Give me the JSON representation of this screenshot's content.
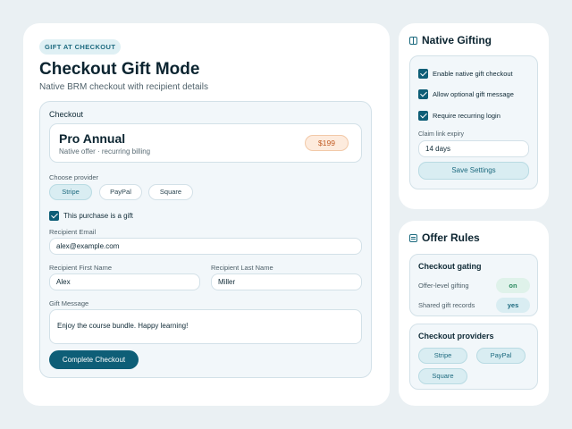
{
  "main": {
    "badge": "GIFT AT CHECKOUT",
    "title": "Checkout Gift Mode",
    "subtitle": "Native BRM checkout with recipient details",
    "checkout": {
      "heading": "Checkout",
      "product": {
        "name": "Pro Annual",
        "description": "Native offer · recurring billing",
        "price": "$199"
      },
      "provider_label": "Choose provider",
      "providers": [
        "Stripe",
        "PayPal",
        "Square"
      ],
      "selected_provider": "Stripe",
      "gift_checkbox_label": "This purchase is a gift",
      "gift_checked": true,
      "recipient_email_label": "Recipient Email",
      "recipient_email_value": "alex@example.com",
      "first_name_label": "Recipient First Name",
      "first_name_value": "Alex",
      "last_name_label": "Recipient Last Name",
      "last_name_value": "Miller",
      "gift_message_label": "Gift Message",
      "gift_message_value": "Enjoy the course bundle. Happy learning!",
      "complete_button": "Complete  Checkout"
    }
  },
  "native_gifting": {
    "title": "Native Gifting",
    "icon": "gift-icon",
    "options": [
      {
        "label": "Enable native gift checkout",
        "checked": true
      },
      {
        "label": "Allow optional gift message",
        "checked": true
      },
      {
        "label": "Require recurring login",
        "checked": true
      }
    ],
    "claim_expiry_label": "Claim link expiry",
    "claim_expiry_value": "14 days",
    "save_button": "Save Settings"
  },
  "offer_rules": {
    "title": "Offer Rules",
    "icon": "list-icon",
    "gating": {
      "title": "Checkout gating",
      "rows": [
        {
          "label": "Offer-level gifting",
          "value": "on"
        },
        {
          "label": "Shared gift records",
          "value": "yes"
        }
      ]
    },
    "providers": {
      "title": "Checkout providers",
      "items": [
        "Stripe",
        "PayPal",
        "Square"
      ]
    }
  },
  "colors": {
    "accent": "#0e5e77",
    "background": "#eaf0f3",
    "price_tag": "#c15a22"
  }
}
